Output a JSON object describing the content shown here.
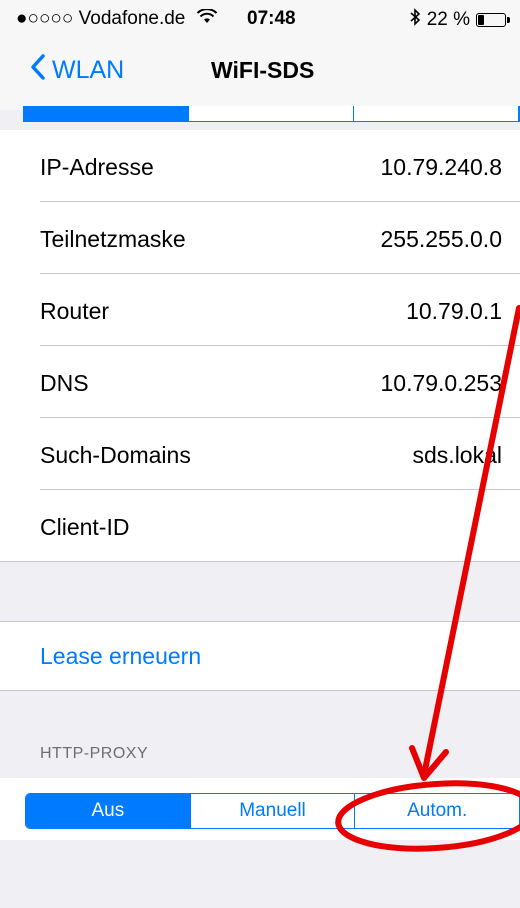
{
  "status_bar": {
    "carrier": "●○○○○ Vodafone.de",
    "time": "07:48",
    "battery_text": "22 %",
    "battery_level": 0.22
  },
  "nav": {
    "back_label": "WLAN",
    "title": "WiFI-SDS"
  },
  "details": [
    {
      "label": "IP-Adresse",
      "value": "10.79.240.8"
    },
    {
      "label": "Teilnetzmaske",
      "value": "255.255.0.0"
    },
    {
      "label": "Router",
      "value": "10.79.0.1"
    },
    {
      "label": "DNS",
      "value": "10.79.0.253"
    },
    {
      "label": "Such-Domains",
      "value": "sds.lokal"
    },
    {
      "label": "Client-ID",
      "value": ""
    }
  ],
  "lease": {
    "label": "Lease erneuern"
  },
  "http_proxy": {
    "header": "HTTP-PROXY",
    "options": [
      "Aus",
      "Manuell",
      "Autom."
    ],
    "selected": "Aus"
  },
  "colors": {
    "accent": "#007aff",
    "annotation": "#e60000"
  }
}
